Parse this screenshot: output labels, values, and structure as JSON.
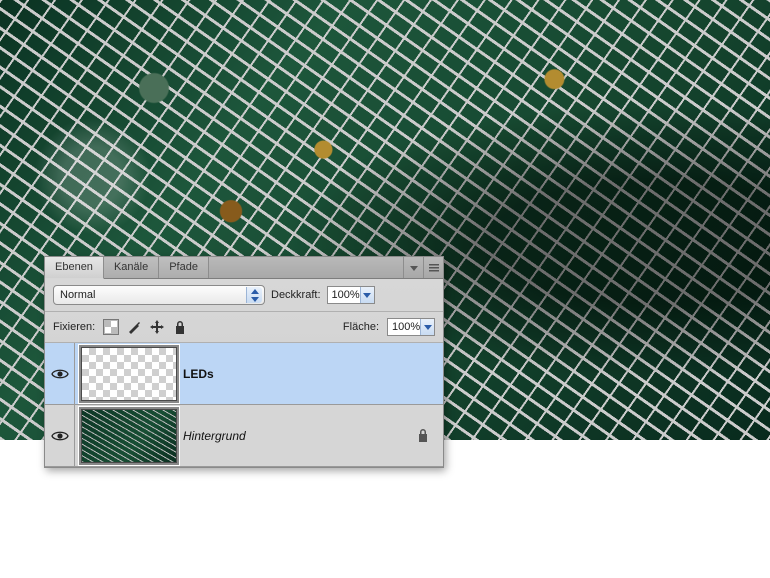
{
  "panel": {
    "tabs": [
      {
        "label": "Ebenen",
        "active": true
      },
      {
        "label": "Kanäle",
        "active": false
      },
      {
        "label": "Pfade",
        "active": false
      }
    ],
    "blend_mode": "Normal",
    "opacity": {
      "label": "Deckkraft:",
      "value": "100%"
    },
    "fill": {
      "label": "Fläche:",
      "value": "100%"
    },
    "lock_label": "Fixieren:"
  },
  "layers": [
    {
      "name": "LEDs",
      "bold": true,
      "italic": false,
      "selected": true,
      "locked": false,
      "thumb": "transparent"
    },
    {
      "name": "Hintergrund",
      "bold": false,
      "italic": true,
      "selected": false,
      "locked": true,
      "thumb": "pcb"
    }
  ]
}
